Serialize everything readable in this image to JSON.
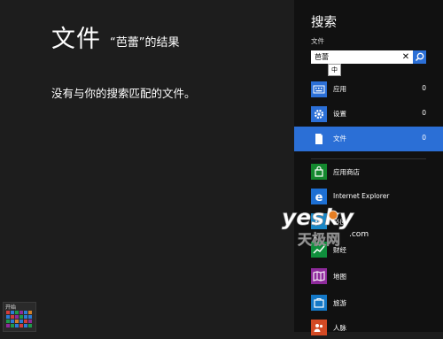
{
  "main": {
    "title": "文件",
    "subtitle": "“芭蕾”的结果",
    "no_results": "没有与你的搜索匹配的文件。"
  },
  "start": {
    "label": "开始"
  },
  "search_pane": {
    "title": "搜索",
    "scope": "文件",
    "query": "芭蕾",
    "ime_indicator": "中",
    "categories": [
      {
        "label": "应用",
        "count": "0",
        "icon": "keyboard-icon",
        "color": "#2b6fd6"
      },
      {
        "label": "设置",
        "count": "0",
        "icon": "gear-icon",
        "color": "#2b6fd6"
      },
      {
        "label": "文件",
        "count": "0",
        "icon": "document-icon",
        "color": "#2b6fd6"
      }
    ],
    "apps": [
      {
        "label": "应用商店",
        "icon": "store-icon",
        "color": "#14882e"
      },
      {
        "label": "Internet Explorer",
        "icon": "ie-icon",
        "color": "#1d6fd3"
      },
      {
        "label": "必应",
        "icon": "bing-icon",
        "color": "#1a87c6"
      },
      {
        "label": "财经",
        "icon": "finance-icon",
        "color": "#0f8f3c"
      },
      {
        "label": "地图",
        "icon": "maps-icon",
        "color": "#8e2a9b"
      },
      {
        "label": "旅游",
        "icon": "travel-icon",
        "color": "#1478c6"
      },
      {
        "label": "人脉",
        "icon": "people-icon",
        "color": "#d34a24"
      }
    ]
  },
  "watermark": {
    "brand": "yesky",
    "sub": "天极网",
    "domain": ".com"
  },
  "colors": {
    "accent": "#2b6fd6",
    "background": "#1d1d1d",
    "pane": "#111111"
  }
}
